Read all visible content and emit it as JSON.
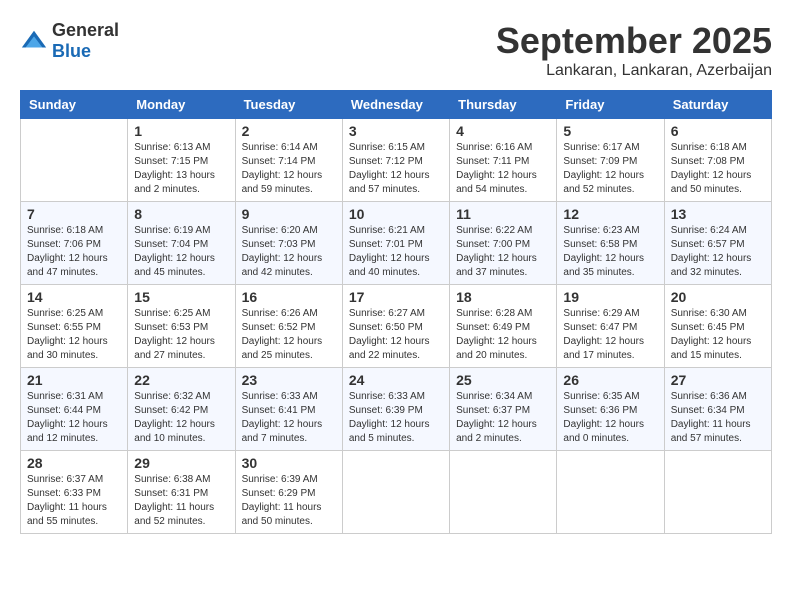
{
  "logo": {
    "text_general": "General",
    "text_blue": "Blue"
  },
  "title": "September 2025",
  "location": "Lankaran, Lankaran, Azerbaijan",
  "days_of_week": [
    "Sunday",
    "Monday",
    "Tuesday",
    "Wednesday",
    "Thursday",
    "Friday",
    "Saturday"
  ],
  "weeks": [
    [
      {
        "day": "",
        "sunrise": "",
        "sunset": "",
        "daylight": ""
      },
      {
        "day": "1",
        "sunrise": "Sunrise: 6:13 AM",
        "sunset": "Sunset: 7:15 PM",
        "daylight": "Daylight: 13 hours and 2 minutes."
      },
      {
        "day": "2",
        "sunrise": "Sunrise: 6:14 AM",
        "sunset": "Sunset: 7:14 PM",
        "daylight": "Daylight: 12 hours and 59 minutes."
      },
      {
        "day": "3",
        "sunrise": "Sunrise: 6:15 AM",
        "sunset": "Sunset: 7:12 PM",
        "daylight": "Daylight: 12 hours and 57 minutes."
      },
      {
        "day": "4",
        "sunrise": "Sunrise: 6:16 AM",
        "sunset": "Sunset: 7:11 PM",
        "daylight": "Daylight: 12 hours and 54 minutes."
      },
      {
        "day": "5",
        "sunrise": "Sunrise: 6:17 AM",
        "sunset": "Sunset: 7:09 PM",
        "daylight": "Daylight: 12 hours and 52 minutes."
      },
      {
        "day": "6",
        "sunrise": "Sunrise: 6:18 AM",
        "sunset": "Sunset: 7:08 PM",
        "daylight": "Daylight: 12 hours and 50 minutes."
      }
    ],
    [
      {
        "day": "7",
        "sunrise": "Sunrise: 6:18 AM",
        "sunset": "Sunset: 7:06 PM",
        "daylight": "Daylight: 12 hours and 47 minutes."
      },
      {
        "day": "8",
        "sunrise": "Sunrise: 6:19 AM",
        "sunset": "Sunset: 7:04 PM",
        "daylight": "Daylight: 12 hours and 45 minutes."
      },
      {
        "day": "9",
        "sunrise": "Sunrise: 6:20 AM",
        "sunset": "Sunset: 7:03 PM",
        "daylight": "Daylight: 12 hours and 42 minutes."
      },
      {
        "day": "10",
        "sunrise": "Sunrise: 6:21 AM",
        "sunset": "Sunset: 7:01 PM",
        "daylight": "Daylight: 12 hours and 40 minutes."
      },
      {
        "day": "11",
        "sunrise": "Sunrise: 6:22 AM",
        "sunset": "Sunset: 7:00 PM",
        "daylight": "Daylight: 12 hours and 37 minutes."
      },
      {
        "day": "12",
        "sunrise": "Sunrise: 6:23 AM",
        "sunset": "Sunset: 6:58 PM",
        "daylight": "Daylight: 12 hours and 35 minutes."
      },
      {
        "day": "13",
        "sunrise": "Sunrise: 6:24 AM",
        "sunset": "Sunset: 6:57 PM",
        "daylight": "Daylight: 12 hours and 32 minutes."
      }
    ],
    [
      {
        "day": "14",
        "sunrise": "Sunrise: 6:25 AM",
        "sunset": "Sunset: 6:55 PM",
        "daylight": "Daylight: 12 hours and 30 minutes."
      },
      {
        "day": "15",
        "sunrise": "Sunrise: 6:25 AM",
        "sunset": "Sunset: 6:53 PM",
        "daylight": "Daylight: 12 hours and 27 minutes."
      },
      {
        "day": "16",
        "sunrise": "Sunrise: 6:26 AM",
        "sunset": "Sunset: 6:52 PM",
        "daylight": "Daylight: 12 hours and 25 minutes."
      },
      {
        "day": "17",
        "sunrise": "Sunrise: 6:27 AM",
        "sunset": "Sunset: 6:50 PM",
        "daylight": "Daylight: 12 hours and 22 minutes."
      },
      {
        "day": "18",
        "sunrise": "Sunrise: 6:28 AM",
        "sunset": "Sunset: 6:49 PM",
        "daylight": "Daylight: 12 hours and 20 minutes."
      },
      {
        "day": "19",
        "sunrise": "Sunrise: 6:29 AM",
        "sunset": "Sunset: 6:47 PM",
        "daylight": "Daylight: 12 hours and 17 minutes."
      },
      {
        "day": "20",
        "sunrise": "Sunrise: 6:30 AM",
        "sunset": "Sunset: 6:45 PM",
        "daylight": "Daylight: 12 hours and 15 minutes."
      }
    ],
    [
      {
        "day": "21",
        "sunrise": "Sunrise: 6:31 AM",
        "sunset": "Sunset: 6:44 PM",
        "daylight": "Daylight: 12 hours and 12 minutes."
      },
      {
        "day": "22",
        "sunrise": "Sunrise: 6:32 AM",
        "sunset": "Sunset: 6:42 PM",
        "daylight": "Daylight: 12 hours and 10 minutes."
      },
      {
        "day": "23",
        "sunrise": "Sunrise: 6:33 AM",
        "sunset": "Sunset: 6:41 PM",
        "daylight": "Daylight: 12 hours and 7 minutes."
      },
      {
        "day": "24",
        "sunrise": "Sunrise: 6:33 AM",
        "sunset": "Sunset: 6:39 PM",
        "daylight": "Daylight: 12 hours and 5 minutes."
      },
      {
        "day": "25",
        "sunrise": "Sunrise: 6:34 AM",
        "sunset": "Sunset: 6:37 PM",
        "daylight": "Daylight: 12 hours and 2 minutes."
      },
      {
        "day": "26",
        "sunrise": "Sunrise: 6:35 AM",
        "sunset": "Sunset: 6:36 PM",
        "daylight": "Daylight: 12 hours and 0 minutes."
      },
      {
        "day": "27",
        "sunrise": "Sunrise: 6:36 AM",
        "sunset": "Sunset: 6:34 PM",
        "daylight": "Daylight: 11 hours and 57 minutes."
      }
    ],
    [
      {
        "day": "28",
        "sunrise": "Sunrise: 6:37 AM",
        "sunset": "Sunset: 6:33 PM",
        "daylight": "Daylight: 11 hours and 55 minutes."
      },
      {
        "day": "29",
        "sunrise": "Sunrise: 6:38 AM",
        "sunset": "Sunset: 6:31 PM",
        "daylight": "Daylight: 11 hours and 52 minutes."
      },
      {
        "day": "30",
        "sunrise": "Sunrise: 6:39 AM",
        "sunset": "Sunset: 6:29 PM",
        "daylight": "Daylight: 11 hours and 50 minutes."
      },
      {
        "day": "",
        "sunrise": "",
        "sunset": "",
        "daylight": ""
      },
      {
        "day": "",
        "sunrise": "",
        "sunset": "",
        "daylight": ""
      },
      {
        "day": "",
        "sunrise": "",
        "sunset": "",
        "daylight": ""
      },
      {
        "day": "",
        "sunrise": "",
        "sunset": "",
        "daylight": ""
      }
    ]
  ]
}
